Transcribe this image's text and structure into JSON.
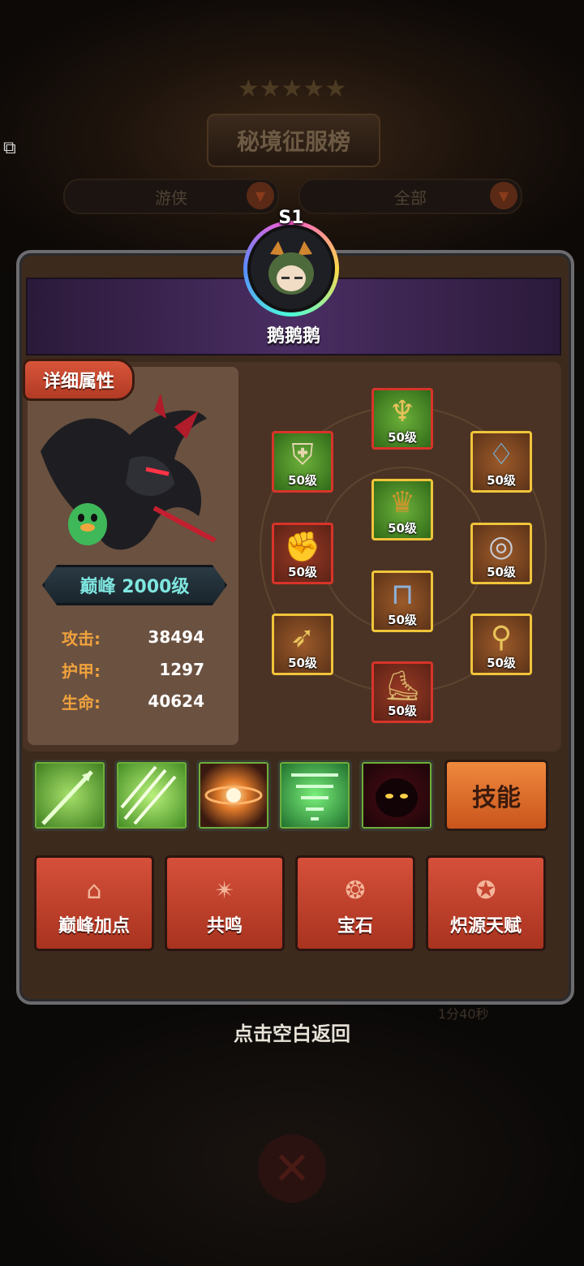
{
  "background": {
    "title": "秘境征服榜",
    "filters": [
      {
        "label": "游侠"
      },
      {
        "label": "全部"
      }
    ],
    "timer": "1分40秒"
  },
  "player": {
    "season_badge": "S1",
    "name": "鹅鹅鹅"
  },
  "details": {
    "tab_label": "详细属性",
    "level_text": "巅峰 2000级",
    "stats": [
      {
        "label": "攻击:",
        "value": "38494"
      },
      {
        "label": "护甲:",
        "value": "1297"
      },
      {
        "label": "生命:",
        "value": "40624"
      }
    ]
  },
  "equipment": [
    {
      "slot": "helmet-antlers",
      "icon": "antler-helm-icon",
      "level": "50级"
    },
    {
      "slot": "chest",
      "icon": "breastplate-icon",
      "level": "50级"
    },
    {
      "slot": "helmet",
      "icon": "horned-helm-icon",
      "level": "50级"
    },
    {
      "slot": "necklace",
      "icon": "necklace-icon",
      "level": "50级"
    },
    {
      "slot": "gloves",
      "icon": "gauntlet-icon",
      "level": "50级"
    },
    {
      "slot": "ring",
      "icon": "ring-icon",
      "level": "50级"
    },
    {
      "slot": "pants",
      "icon": "pants-icon",
      "level": "50级"
    },
    {
      "slot": "bow",
      "icon": "bow-icon",
      "level": "50级"
    },
    {
      "slot": "quiver",
      "icon": "quiver-icon",
      "level": "50级"
    },
    {
      "slot": "boots",
      "icon": "boots-icon",
      "level": "50级"
    }
  ],
  "skills": [
    {
      "icon": "arrow-strike-icon",
      "color": "#4fa12c"
    },
    {
      "icon": "arrow-rain-icon",
      "color": "#58b830"
    },
    {
      "icon": "orb-icon",
      "color": "#b8501c"
    },
    {
      "icon": "tornado-icon",
      "color": "#2e9e40"
    },
    {
      "icon": "shadow-icon",
      "color": "#7a1020"
    }
  ],
  "skill_button": "技能",
  "actions": [
    {
      "label": "巅峰加点",
      "icon": "house-plus-icon"
    },
    {
      "label": "共鸣",
      "icon": "resonance-icon"
    },
    {
      "label": "宝石",
      "icon": "gem-icon"
    },
    {
      "label": "炽源天赋",
      "icon": "talent-icon"
    }
  ],
  "footer": {
    "tap_back": "点击空白返回"
  }
}
